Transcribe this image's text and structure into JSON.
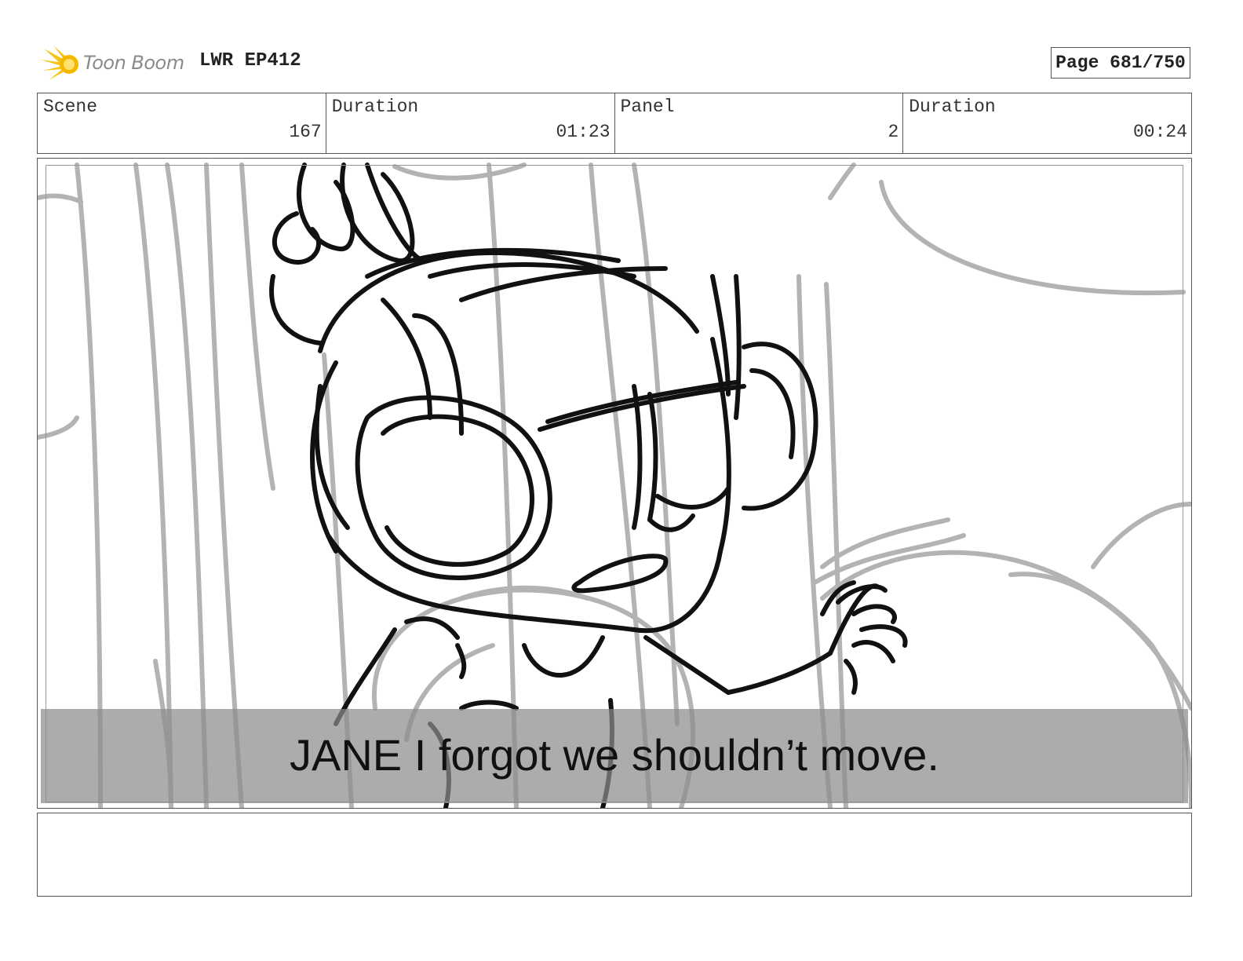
{
  "header": {
    "logo_text": "Toon Boom",
    "project_title": "LWR EP412",
    "page_indicator": "Page 681/750"
  },
  "info": {
    "scene_label": "Scene",
    "scene_value": "167",
    "scene_duration_label": "Duration",
    "scene_duration_value": "01:23",
    "panel_label": "Panel",
    "panel_value": "2",
    "panel_duration_label": "Duration",
    "panel_duration_value": "00:24"
  },
  "panel": {
    "caption": "JANE I forgot we shouldn’t move."
  },
  "notes": {
    "text": ""
  },
  "colors": {
    "logo_accent": "#f5c518",
    "sketch_dark": "#111111",
    "sketch_light": "#b0b0b0"
  }
}
